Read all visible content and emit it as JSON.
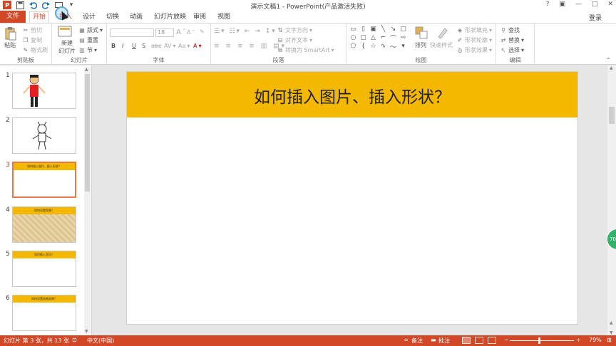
{
  "title_bar": {
    "title": "演示文稿1 - PowerPoint(产品激活失败)",
    "app_logo": "P",
    "qat": {
      "save": "save-icon",
      "undo": "undo-icon",
      "redo": "redo-icon",
      "start": "present-icon"
    },
    "win_controls": {
      "help": "?",
      "restore": "▣",
      "minimize": "—",
      "maximize": "□",
      "close": "✕"
    }
  },
  "tabs": {
    "file": "文件",
    "home": "开始",
    "insert": "插入",
    "design": "设计",
    "transitions": "切换",
    "animations": "动画",
    "slideshow": "幻灯片放映",
    "review": "审阅",
    "view": "视图",
    "login": "登录"
  },
  "ribbon": {
    "clipboard": {
      "label": "剪贴板",
      "paste": "粘贴",
      "cut": "剪切",
      "copy": "复制",
      "format_painter": "格式刷"
    },
    "slides": {
      "label": "幻灯片",
      "new_slide": "新建",
      "new_slide_2": "幻灯片",
      "layout": "版式",
      "reset": "重置",
      "section": "节"
    },
    "font": {
      "label": "字体",
      "font_name": "",
      "font_size": "18",
      "grow": "A",
      "shrink": "A",
      "clear": "✎",
      "bold": "B",
      "italic": "I",
      "underline": "U",
      "shadow": "S",
      "strike": "abc",
      "spacing": "AV",
      "case": "Aa",
      "color": "A"
    },
    "paragraph": {
      "label": "段落",
      "text_direction": "文字方向",
      "align_text": "对齐文本",
      "smartart": "转换为 SmartArt"
    },
    "drawing": {
      "label": "绘图",
      "arrange": "排列",
      "quick_styles": "快速样式",
      "fill": "形状填充",
      "outline": "形状轮廓",
      "effects": "形状效果"
    },
    "editing": {
      "label": "编辑",
      "find": "查找",
      "replace": "替换",
      "select": "选择"
    }
  },
  "slides": [
    {
      "num": "1",
      "title": ""
    },
    {
      "num": "2",
      "title": ""
    },
    {
      "num": "3",
      "title": "如何插入图片、插入形状？"
    },
    {
      "num": "4",
      "title": "如何设置背景？"
    },
    {
      "num": "5",
      "title": "如何插入音乐？"
    },
    {
      "num": "6",
      "title": "如何设置动画效果？"
    }
  ],
  "main_slide": {
    "title": "如何插入图片、插入形状？",
    "header_color": "#f5b800"
  },
  "status": {
    "slide_info": "幻灯片 第 3 张，共 13 张",
    "language": "中文(中国)",
    "notes": "备注",
    "comments": "批注",
    "zoom_minus": "−",
    "zoom_plus": "+",
    "zoom": "79%",
    "badge": "70"
  },
  "colors": {
    "accent": "#d24726",
    "slide_header": "#f5b800",
    "selected_thumb": "#e6784a"
  }
}
